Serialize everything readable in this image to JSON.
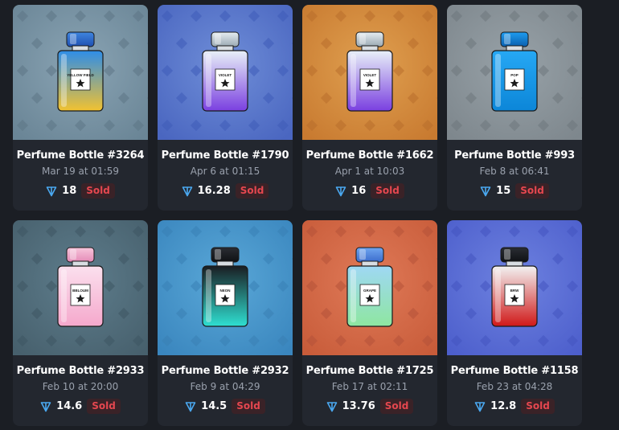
{
  "icons": {
    "currency": "ton-diamond-icon"
  },
  "items": [
    {
      "title": "Perfume Bottle #3264",
      "date": "Mar 19 at 01:59",
      "price": "18",
      "status": "Sold",
      "bg": [
        "#8aa4b4",
        "#6a8596"
      ],
      "pattern_color": "#5d7686",
      "cap": [
        "#3f86e0",
        "#1f4fb0"
      ],
      "glass": [
        "#2e8de8",
        "#f2c230"
      ],
      "label": "YELLOW FIELD"
    },
    {
      "title": "Perfume Bottle #1790",
      "date": "Apr 6 at 01:15",
      "price": "16.28",
      "status": "Sold",
      "bg": [
        "#6f8ed8",
        "#4a66c0"
      ],
      "pattern_color": "#3f5cb8",
      "cap": [
        "#e6eef2",
        "#9aa8b2"
      ],
      "glass": [
        "#e8f0f8",
        "#7a3fe0"
      ],
      "label": "VIOLET"
    },
    {
      "title": "Perfume Bottle #1662",
      "date": "Apr 1 at 10:03",
      "price": "16",
      "status": "Sold",
      "bg": [
        "#e0a050",
        "#c87a30"
      ],
      "pattern_color": "#b86e2c",
      "cap": [
        "#e6eef2",
        "#9aa8b2"
      ],
      "glass": [
        "#e8f0f8",
        "#7a3fe0"
      ],
      "label": "VIOLET"
    },
    {
      "title": "Perfume Bottle #993",
      "date": "Feb 8 at 06:41",
      "price": "15",
      "status": "Sold",
      "bg": [
        "#98a2a8",
        "#7e878d"
      ],
      "pattern_color": "#6e777d",
      "cap": [
        "#1e9cf0",
        "#0a5fae"
      ],
      "glass": [
        "#26a8f4",
        "#0c86d8"
      ],
      "label": "POP"
    },
    {
      "title": "Perfume Bottle #2933",
      "date": "Feb 10 at 20:00",
      "price": "14.6",
      "status": "Sold",
      "bg": [
        "#5e7d8c",
        "#47606d"
      ],
      "pattern_color": "#3e5663",
      "cap": [
        "#f7c6dc",
        "#e48ab6"
      ],
      "glass": [
        "#fbe0ee",
        "#f5a8cc"
      ],
      "label": "BBLOUM"
    },
    {
      "title": "Perfume Bottle #2932",
      "date": "Feb 9 at 04:29",
      "price": "14.5",
      "status": "Sold",
      "bg": [
        "#5aa8d8",
        "#3a86be"
      ],
      "pattern_color": "#3a80b4",
      "cap": [
        "#2a2d33",
        "#0f1114"
      ],
      "glass": [
        "#1a1d22",
        "#2fe0d2"
      ],
      "label": "NEON"
    },
    {
      "title": "Perfume Bottle #1725",
      "date": "Feb 17 at 02:11",
      "price": "13.76",
      "status": "Sold",
      "bg": [
        "#e07a58",
        "#c85c3a"
      ],
      "pattern_color": "#b4523a",
      "cap": [
        "#6fa6f0",
        "#3b6ccc"
      ],
      "glass": [
        "#9fd8f4",
        "#8ee6a0"
      ],
      "label": "GRAPE"
    },
    {
      "title": "Perfume Bottle #1158",
      "date": "Feb 23 at 04:28",
      "price": "12.8",
      "status": "Sold",
      "bg": [
        "#6e82e0",
        "#4d5fcc"
      ],
      "pattern_color": "#4455c0",
      "cap": [
        "#2a2d33",
        "#0f1114"
      ],
      "glass": [
        "#f2f2f2",
        "#d01818"
      ],
      "label": "BRW"
    }
  ]
}
